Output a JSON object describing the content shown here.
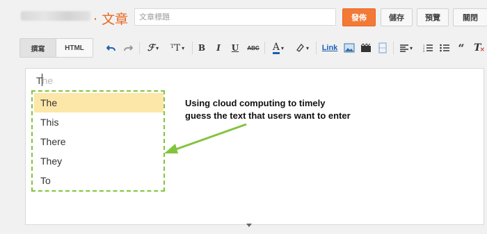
{
  "header": {
    "post_label": "· 文章",
    "title_placeholder": "文章標題",
    "publish_label": "發佈",
    "save_label": "儲存",
    "preview_label": "預覽",
    "close_label": "關閉"
  },
  "toolbar": {
    "compose_tab": "撰寫",
    "html_tab": "HTML",
    "link_label": "Link",
    "icons": [
      "undo-icon",
      "redo-icon",
      "font-family-icon",
      "font-size-icon",
      "bold-icon",
      "italic-icon",
      "underline-icon",
      "strikethrough-icon",
      "text-color-icon",
      "highlight-color-icon",
      "link",
      "image-icon",
      "video-icon",
      "page-break-icon",
      "align-icon",
      "numbered-list-icon",
      "bullet-list-icon",
      "quote-icon",
      "remove-formatting-icon"
    ]
  },
  "editor": {
    "typed_text": "T",
    "ghost_text": "he",
    "suggestions": [
      "The",
      "This",
      "There",
      "They",
      "To"
    ],
    "selected_index": 0
  },
  "annotation": {
    "line1": "Using cloud computing to timely",
    "line2": "guess the text that users want to enter",
    "border_color": "#82c43c"
  },
  "colors": {
    "accent": "#f27a36",
    "highlight": "#fce7a9",
    "link": "#1a5fb4"
  }
}
